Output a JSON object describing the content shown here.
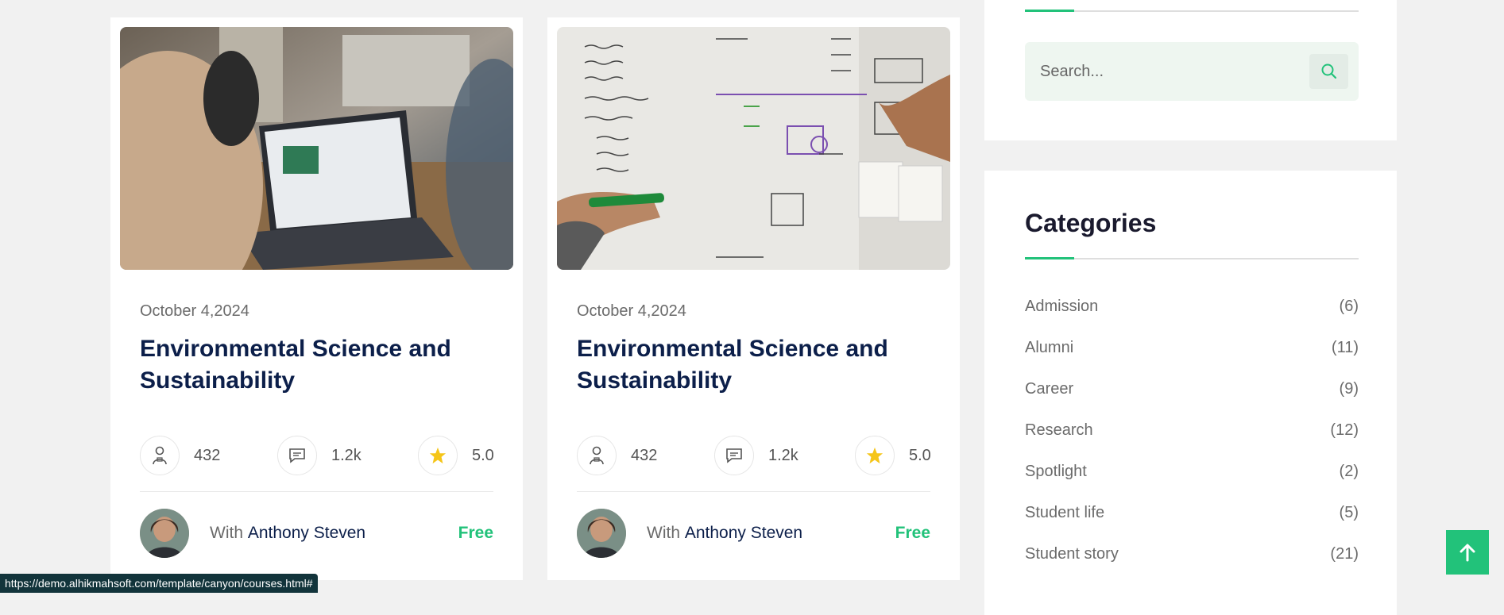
{
  "courses": [
    {
      "image": "photo-person-laptop",
      "date": "October 4,2024",
      "title": "Environmental Science and Sustainability",
      "students": "432",
      "comments": "1.2k",
      "rating": "5.0",
      "author_prefix": "With",
      "author_name": "Anthony Steven",
      "price": "Free"
    },
    {
      "image": "photo-whiteboard-marker",
      "date": "October 4,2024",
      "title": "Environmental Science and Sustainability",
      "students": "432",
      "comments": "1.2k",
      "rating": "5.0",
      "author_prefix": "With",
      "author_name": "Anthony Steven",
      "price": "Free"
    }
  ],
  "search": {
    "placeholder": "Search...",
    "icon": "search-icon"
  },
  "categories": {
    "title": "Categories",
    "items": [
      {
        "name": "Admission",
        "count": "(6)"
      },
      {
        "name": "Alumni",
        "count": "(11)"
      },
      {
        "name": "Career",
        "count": "(9)"
      },
      {
        "name": "Research",
        "count": "(12)"
      },
      {
        "name": "Spotlight",
        "count": "(2)"
      },
      {
        "name": "Student life",
        "count": "(5)"
      },
      {
        "name": "Student story",
        "count": "(21)"
      }
    ]
  },
  "scroll_top": {
    "icon": "arrow-up-icon"
  },
  "status_bar": {
    "url": "https://demo.alhikmahsoft.com/template/canyon/courses.html#"
  },
  "colors": {
    "accent": "#22c27a",
    "title": "#0c1f4a",
    "star": "#f5c518"
  }
}
